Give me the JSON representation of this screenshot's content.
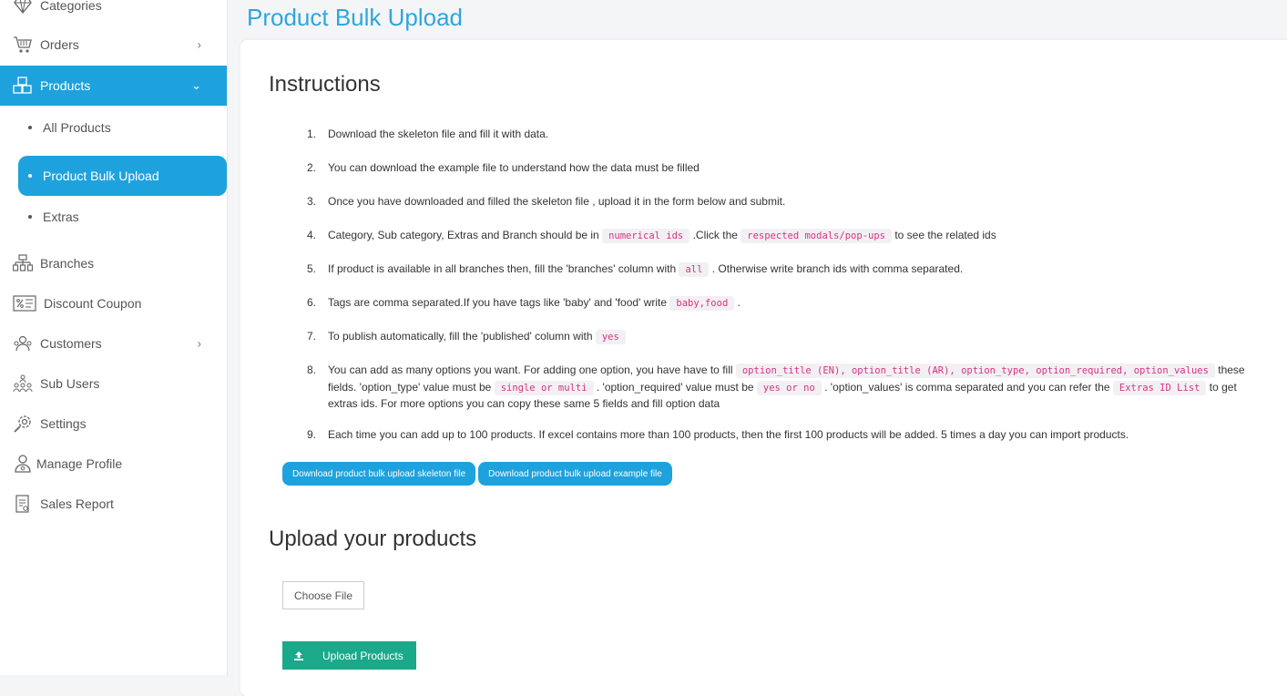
{
  "sidebar": {
    "items": [
      {
        "label": "Categories",
        "icon": "diamond-icon"
      },
      {
        "label": "Orders",
        "icon": "cart-icon",
        "chevron": "›"
      },
      {
        "label": "Products",
        "icon": "boxes-icon",
        "chevron": "⌄"
      },
      {
        "label": "Branches",
        "icon": "branches-icon"
      },
      {
        "label": "Discount Coupon",
        "icon": "coupon-icon"
      },
      {
        "label": "Customers",
        "icon": "customers-icon",
        "chevron": "›"
      },
      {
        "label": "Sub Users",
        "icon": "sub-users-icon"
      },
      {
        "label": "Settings",
        "icon": "gear-icon"
      },
      {
        "label": "Manage Profile",
        "icon": "profile-icon"
      },
      {
        "label": "Sales Report",
        "icon": "report-icon"
      }
    ],
    "products_sub": [
      {
        "label": "All Products"
      },
      {
        "label": "Product Bulk Upload"
      },
      {
        "label": "Extras"
      }
    ],
    "active_color": "#1ea2dd"
  },
  "header": {
    "title": "Product Bulk Upload"
  },
  "instructions": {
    "heading": "Instructions",
    "steps": {
      "s1": {
        "num": "1.",
        "text": "Download the skeleton file and fill it with data."
      },
      "s2": {
        "num": "2.",
        "text": "You can download the example file to understand how the data must be filled"
      },
      "s3": {
        "num": "3.",
        "text": "Once you have downloaded and filled the skeleton file , upload it in the form below and submit."
      },
      "s4": {
        "num": "4.",
        "a": "Category, Sub category, Extras and Branch should be in ",
        "code1": "numerical ids",
        "b": " .Click the ",
        "code2": "respected modals/pop-ups",
        "c": " to see the related ids"
      },
      "s5": {
        "num": "5.",
        "a": "If product is available in all branches then, fill the 'branches' column with ",
        "code1": "all",
        "b": " . Otherwise write branch ids with comma separated."
      },
      "s6": {
        "num": "6.",
        "a": "Tags are comma separated.If you have tags like 'baby' and 'food' write ",
        "code1": "baby,food",
        "b": " ."
      },
      "s7": {
        "num": "7.",
        "a": "To publish automatically, fill the 'published' column with ",
        "code1": "yes"
      },
      "s8": {
        "num": "8.",
        "a": "You can add as many options you want. For adding one option, you have have to fill ",
        "code1": "option_title (EN), option_title (AR), option_type, option_required, option_values",
        "b": " these fields. 'option_type' value must be ",
        "code2": "single or multi",
        "c": " . 'option_required' value must be ",
        "code3": "yes or no",
        "d": " . 'option_values' is comma separated and you can refer the ",
        "code4": "Extras ID List",
        "e": " to get extras ids. For more options you can copy these same 5 fields and fill option data"
      },
      "s9": {
        "num": "9.",
        "text": "Each time you can add up to 100 products. If excel contains more than 100 products, then the first 100 products will be added. 5 times a day you can import products."
      }
    }
  },
  "downloads": {
    "skeleton_label": "Download product bulk upload skeleton file",
    "example_label": "Download product bulk upload example file"
  },
  "upload": {
    "heading": "Upload your products",
    "choose_label": "Choose File",
    "submit_label": "Upload Products",
    "submit_color": "#1aa98a"
  }
}
